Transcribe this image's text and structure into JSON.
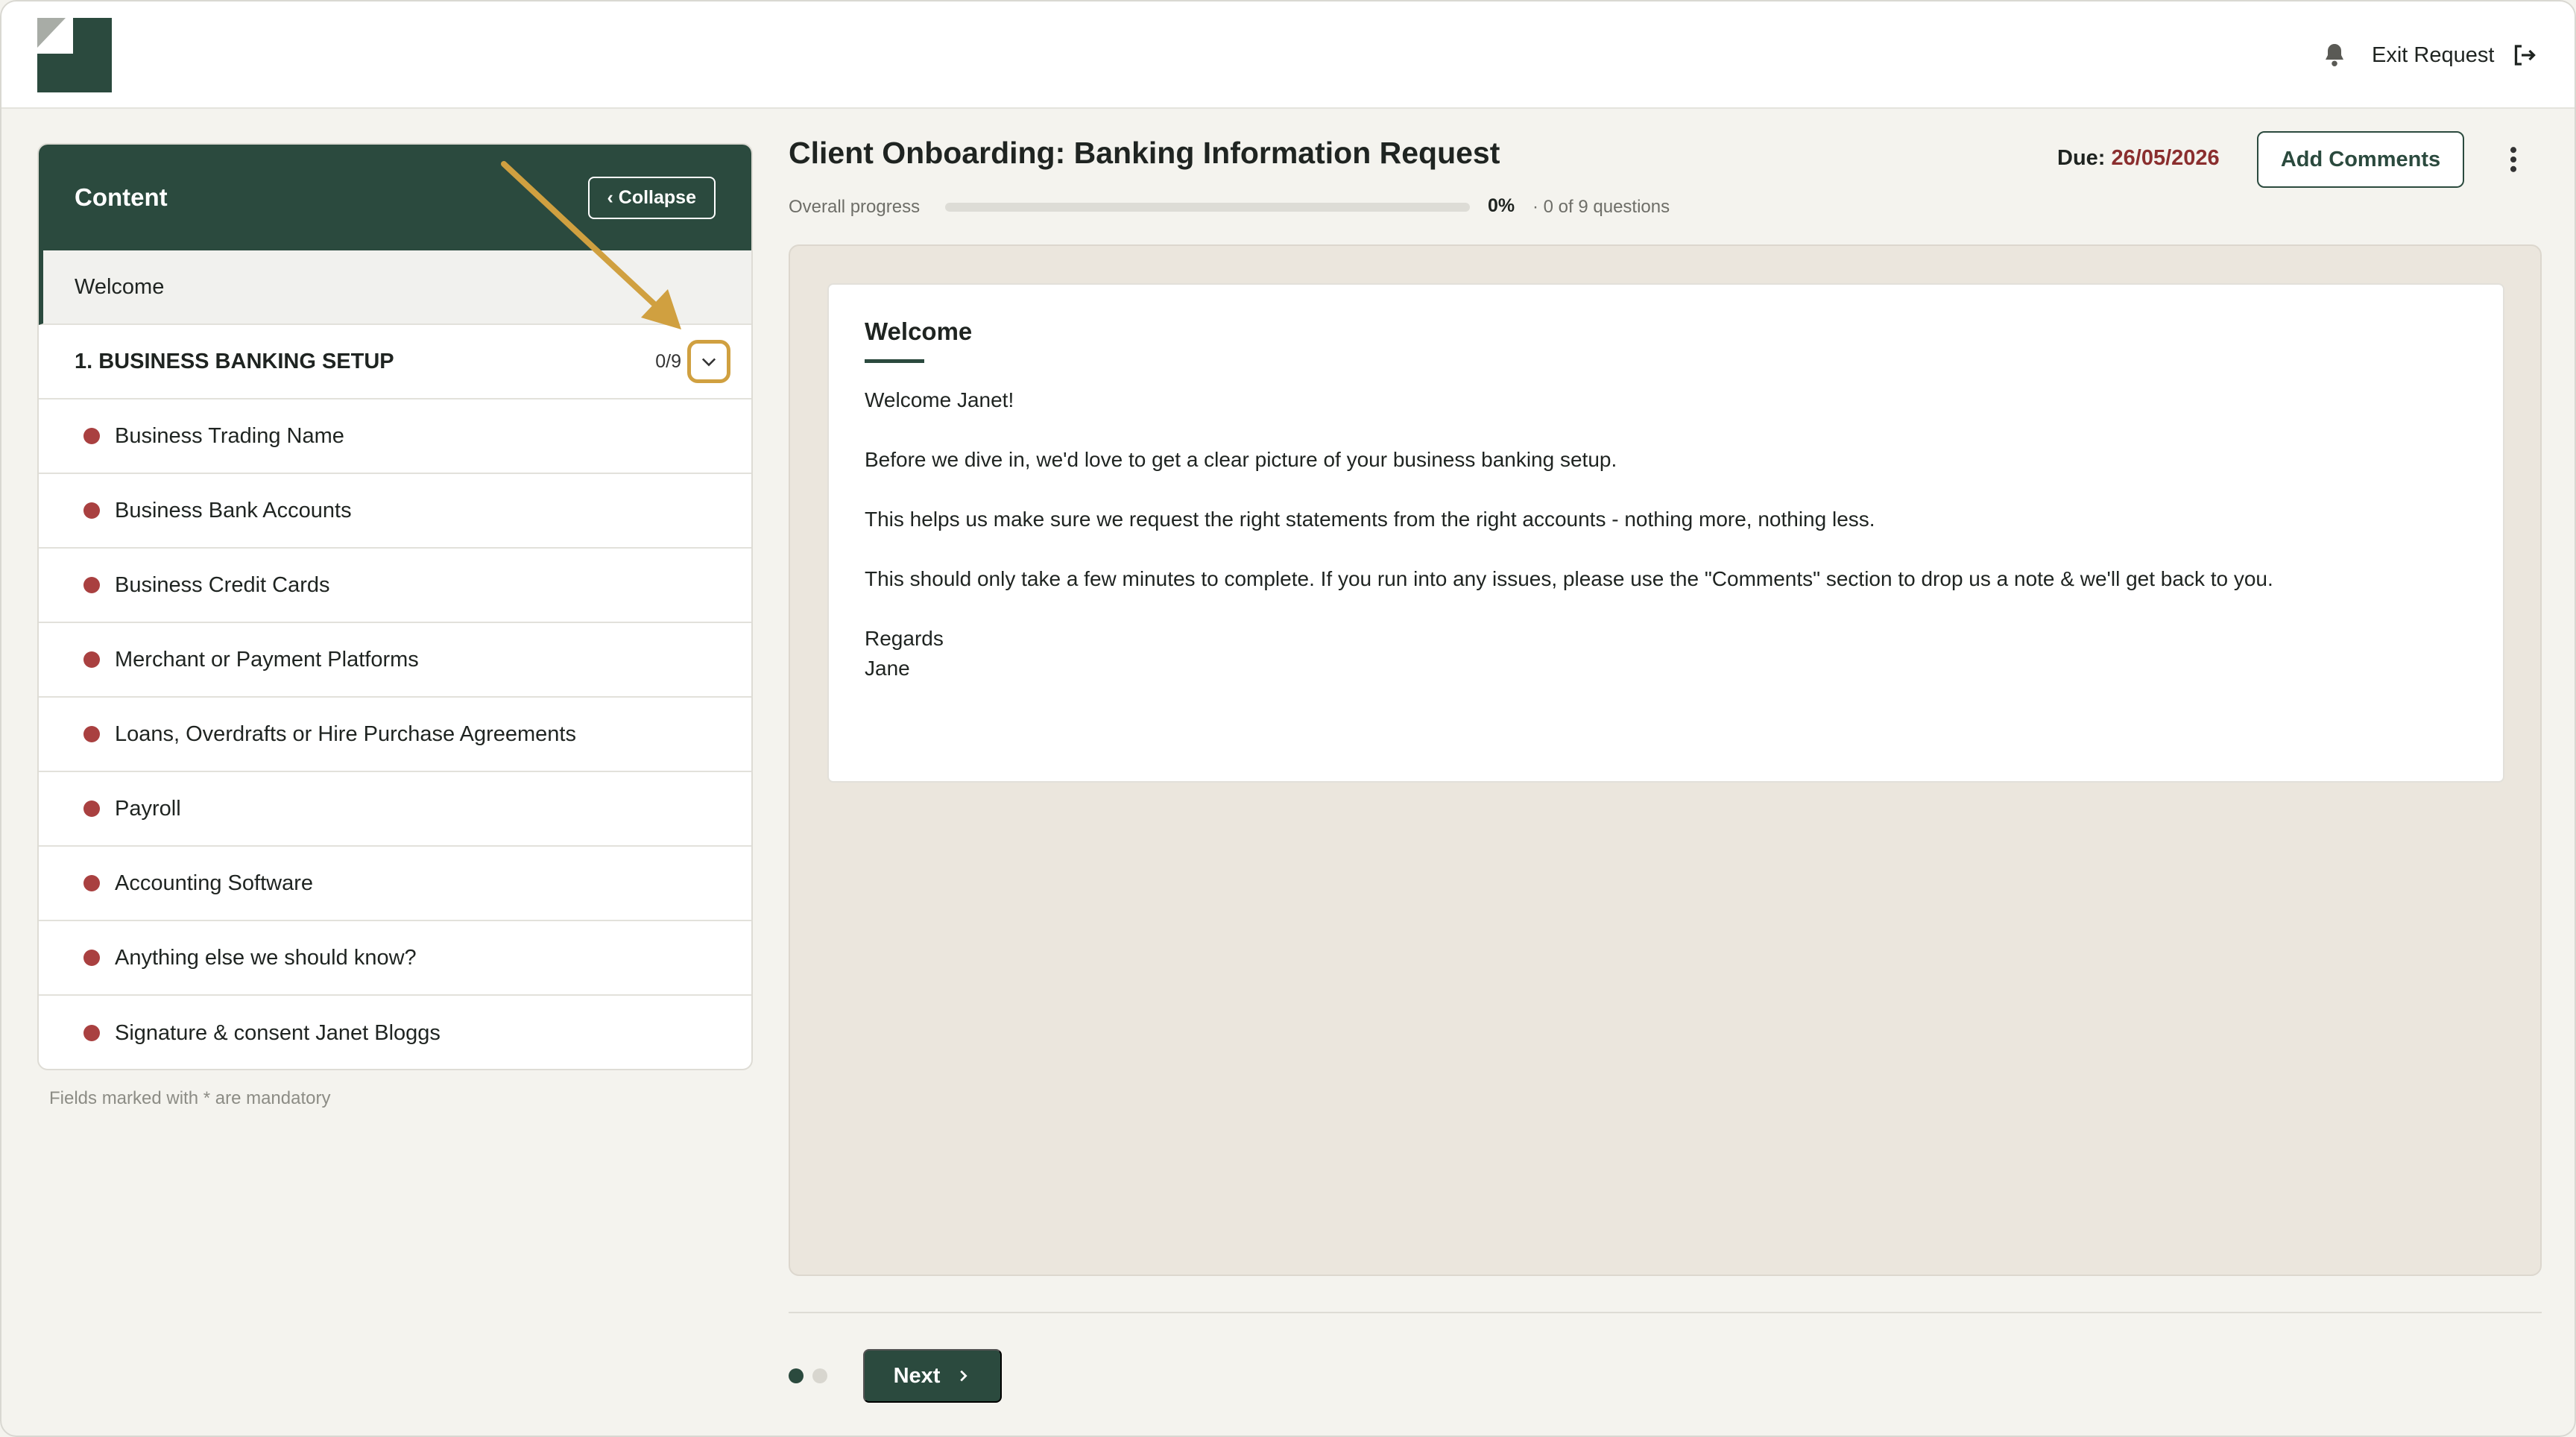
{
  "header": {
    "exit_label": "Exit Request"
  },
  "sidebar": {
    "title": "Content",
    "collapse_label": "‹ Collapse",
    "welcome_label": "Welcome",
    "section": {
      "label": "1. BUSINESS BANKING SETUP",
      "count": "0/9"
    },
    "items": [
      {
        "label": "Business Trading Name"
      },
      {
        "label": "Business Bank Accounts"
      },
      {
        "label": "Business Credit Cards"
      },
      {
        "label": "Merchant or Payment Platforms"
      },
      {
        "label": "Loans, Overdrafts or Hire Purchase Agreements"
      },
      {
        "label": "Payroll"
      },
      {
        "label": "Accounting Software"
      },
      {
        "label": "Anything else we should know?"
      },
      {
        "label": "Signature & consent Janet Bloggs"
      }
    ],
    "note": "Fields marked with * are mandatory"
  },
  "main": {
    "title": "Client Onboarding: Banking Information Request",
    "progress_label": "Overall progress",
    "progress_value": 0,
    "progress_pct": "0%",
    "progress_count": "· 0 of 9 questions",
    "due_label": "Due:",
    "due_date": "26/05/2026",
    "add_comments_label": "Add Comments",
    "card": {
      "title": "Welcome",
      "greeting": "Welcome Janet!",
      "para1": "Before we dive in, we'd love to get a clear picture of your business banking setup.",
      "para2": "This helps us make sure we request the right statements from the right accounts - nothing more, nothing less.",
      "para3": "This should only take a few minutes to complete. If you run into any issues, please use the \"Comments\" section to drop us a note & we'll get back to you.",
      "sign1": "Regards",
      "sign2": "Jane"
    },
    "next_label": "Next"
  },
  "colors": {
    "brand": "#2b4a3e",
    "accent_annotation": "#d0a040",
    "status_red": "#a94040",
    "due_red": "#8a2e2e"
  }
}
